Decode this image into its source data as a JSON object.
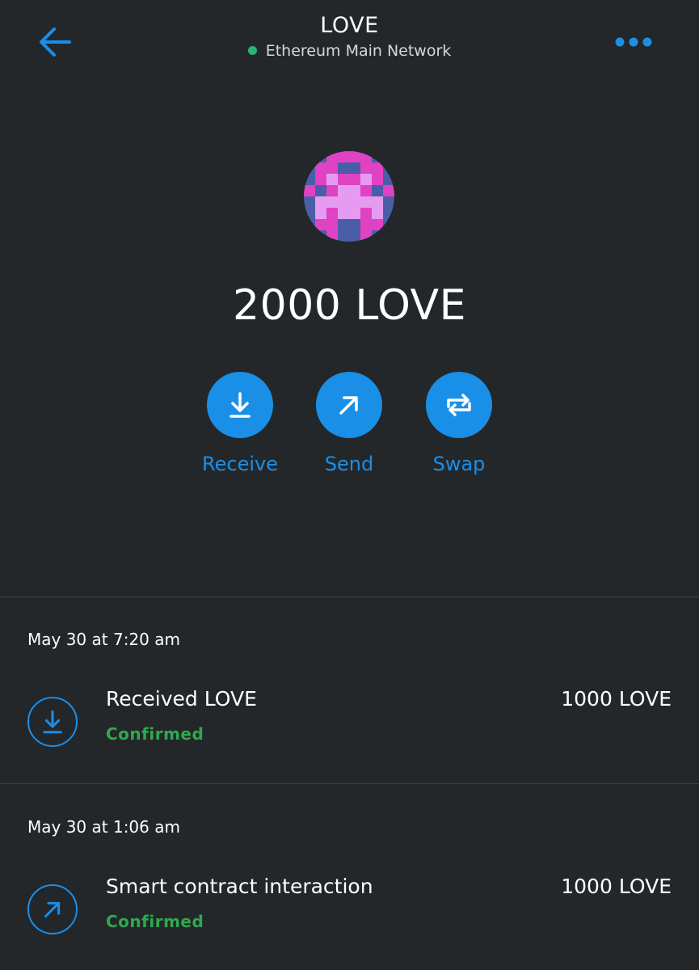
{
  "header": {
    "title": "LOVE",
    "network_name": "Ethereum Main Network",
    "network_status_color": "#29b57a",
    "back_icon": "arrow-left-icon",
    "more_icon": "more-horizontal-icon"
  },
  "token": {
    "symbol": "LOVE",
    "balance": "2000 LOVE",
    "identicon_colors": [
      "#4a5ea8",
      "#e042c4",
      "#e59cf0"
    ]
  },
  "actions": [
    {
      "label": "Receive",
      "icon": "receive-icon"
    },
    {
      "label": "Send",
      "icon": "send-arrow-icon"
    },
    {
      "label": "Swap",
      "icon": "swap-icon"
    }
  ],
  "colors": {
    "accent": "#1a8fe8",
    "button_bg": "#1a8fe8",
    "confirmed": "#30a84f",
    "background": "#24272a"
  },
  "transactions": [
    {
      "date": "May 30 at 7:20 am",
      "title": "Received LOVE",
      "status": "Confirmed",
      "amount": "1000 LOVE",
      "icon": "receive-icon"
    },
    {
      "date": "May 30 at 1:06 am",
      "title": "Smart contract interaction",
      "status": "Confirmed",
      "amount": "1000 LOVE",
      "icon": "send-arrow-icon"
    }
  ]
}
